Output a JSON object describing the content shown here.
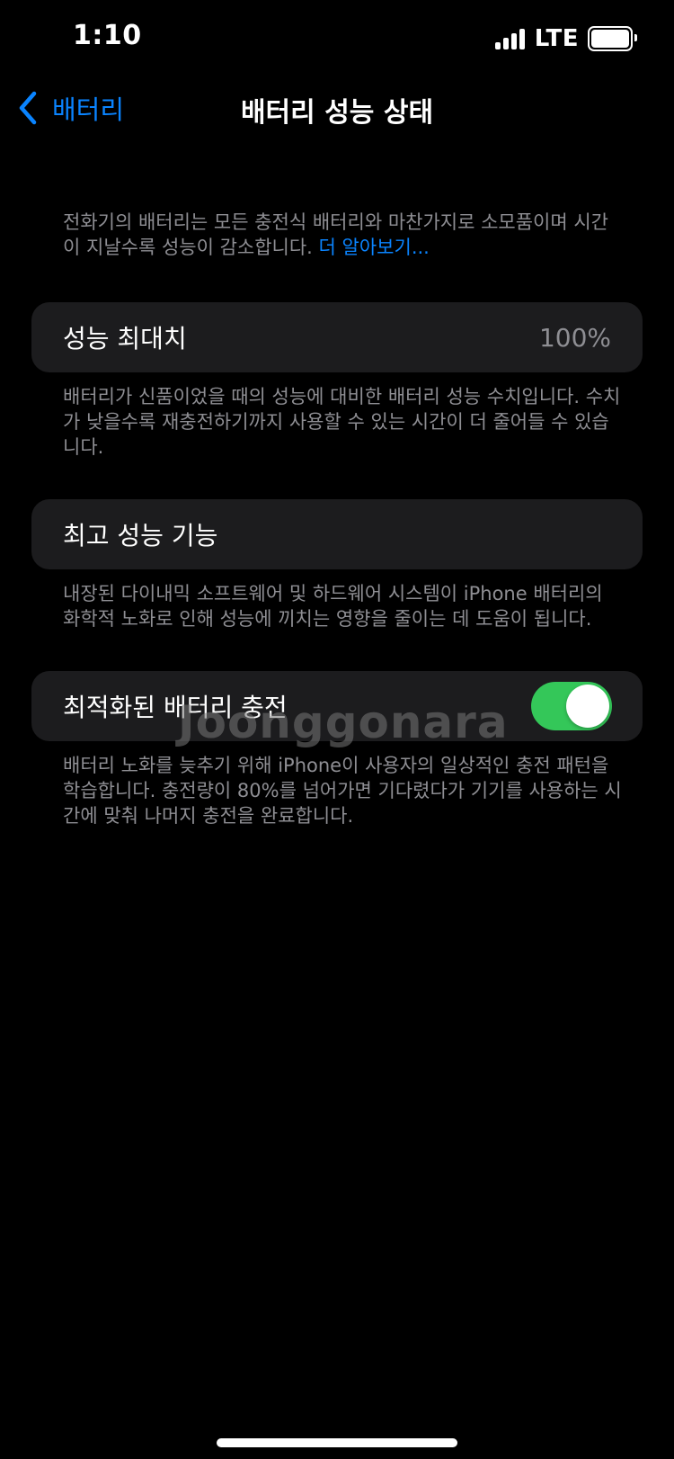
{
  "status_bar": {
    "time": "1:10",
    "network": "LTE",
    "signal_icon": "cellular-signal-icon",
    "battery_icon": "battery-full-icon"
  },
  "nav": {
    "back_label": "배터리",
    "back_icon": "chevron-left-icon",
    "title": "배터리 성능 상태"
  },
  "intro": {
    "text": "전화기의 배터리는 모든 충전식 배터리와 마찬가지로 소모품이며 시간이 지날수록 성능이 감소합니다. ",
    "link": "더 알아보기..."
  },
  "max_capacity": {
    "label": "성능 최대치",
    "value": "100%",
    "description": "배터리가 신품이었을 때의 성능에 대비한 배터리 성능 수치입니다. 수치가 낮을수록 재충전하기까지 사용할 수 있는 시간이 더 줄어들 수 있습니다."
  },
  "peak_performance": {
    "label": "최고 성능 기능",
    "description": "내장된 다이내믹 소프트웨어 및 하드웨어 시스템이 iPhone 배터리의 화학적 노화로 인해 성능에 끼치는 영향을 줄이는 데 도움이 됩니다."
  },
  "optimized_charging": {
    "label": "최적화된 배터리 충전",
    "toggle_on": true,
    "toggle_color": "#34c759",
    "description": "배터리 노화를 늦추기 위해 iPhone이 사용자의 일상적인 충전 패턴을 학습합니다. 충전량이 80%를 넘어가면 기다렸다가 기기를 사용하는 시간에 맞춰 나머지 충전을 완료합니다."
  },
  "watermark": "Joonggonara",
  "colors": {
    "background": "#000000",
    "cell": "#1c1c1e",
    "accent": "#0a84ff",
    "secondary_text": "#8e8e93"
  }
}
